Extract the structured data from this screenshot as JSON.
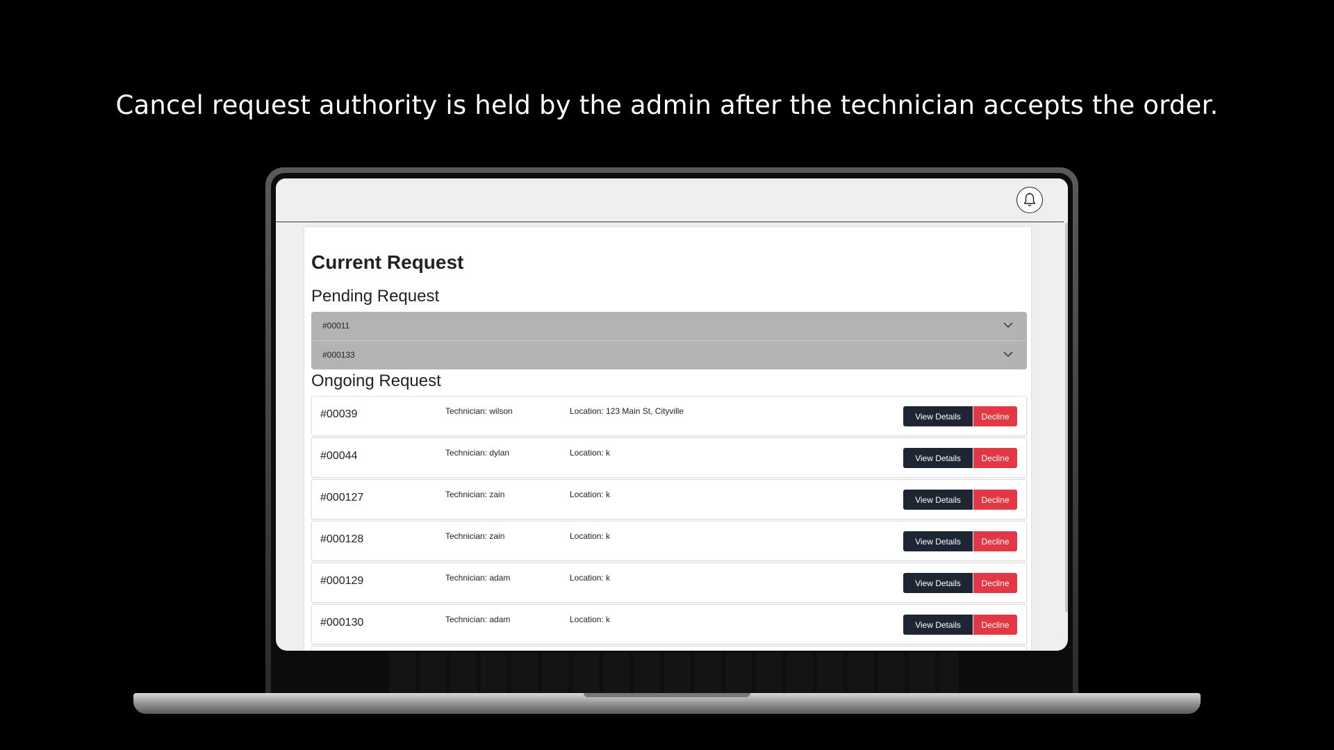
{
  "caption": "Cancel request authority is held by the admin after the technician accepts the order.",
  "app": {
    "page_title": "Current Request",
    "pending_section_title": "Pending Request",
    "ongoing_section_title": "Ongoing Request",
    "topbar": {
      "icon": "bell-icon"
    },
    "pending_requests": [
      {
        "id": "#00011"
      },
      {
        "id": "#000133"
      }
    ],
    "ongoing_requests": [
      {
        "id": "#00039",
        "technician": "Technician: wilson",
        "location": "Location: 123 Main St, Cityville",
        "view_label": "View Details",
        "decline_label": "Decline"
      },
      {
        "id": "#00044",
        "technician": "Technician: dylan",
        "location": "Location: k",
        "view_label": "View Details",
        "decline_label": "Decline"
      },
      {
        "id": "#000127",
        "technician": "Technician: zain",
        "location": "Location: k",
        "view_label": "View Details",
        "decline_label": "Decline"
      },
      {
        "id": "#000128",
        "technician": "Technician: zain",
        "location": "Location: k",
        "view_label": "View Details",
        "decline_label": "Decline"
      },
      {
        "id": "#000129",
        "technician": "Technician: adam",
        "location": "Location: k",
        "view_label": "View Details",
        "decline_label": "Decline"
      },
      {
        "id": "#000130",
        "technician": "Technician: adam",
        "location": "Location: k",
        "view_label": "View Details",
        "decline_label": "Decline"
      }
    ],
    "colors": {
      "view_button": "#1f2633",
      "decline_button": "#e23744",
      "pending_row": "#b3b3b3"
    }
  }
}
